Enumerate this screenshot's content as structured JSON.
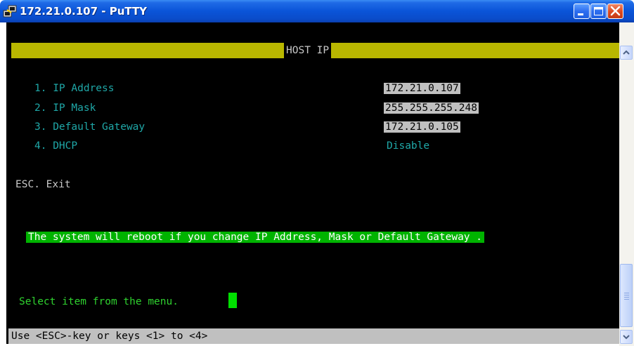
{
  "window": {
    "title": "172.21.0.107 - PuTTY",
    "icon": "putty-icon",
    "controls": [
      "minimize-icon",
      "maximize-icon",
      "close-icon"
    ]
  },
  "terminal": {
    "header": "HOST IP",
    "menu": [
      {
        "label": "1. IP Address",
        "value": "172.21.0.107"
      },
      {
        "label": "2. IP Mask",
        "value": "255.255.255.248"
      },
      {
        "label": "3. Default Gateway",
        "value": "172.21.0.105"
      },
      {
        "label": "4. DHCP",
        "value": "Disable"
      }
    ],
    "exit_option": "ESC. Exit",
    "warning": "The system will reboot if you change IP Address, Mask or Default Gateway .",
    "prompt": "Select item from the menu.",
    "status": "Use <ESC>-key or keys <1> to <4>"
  },
  "colors": {
    "header_bar": "#b9b700",
    "warning_bg": "#00b300",
    "cursor": "#00e000",
    "titlebar": "#0a54d8"
  }
}
